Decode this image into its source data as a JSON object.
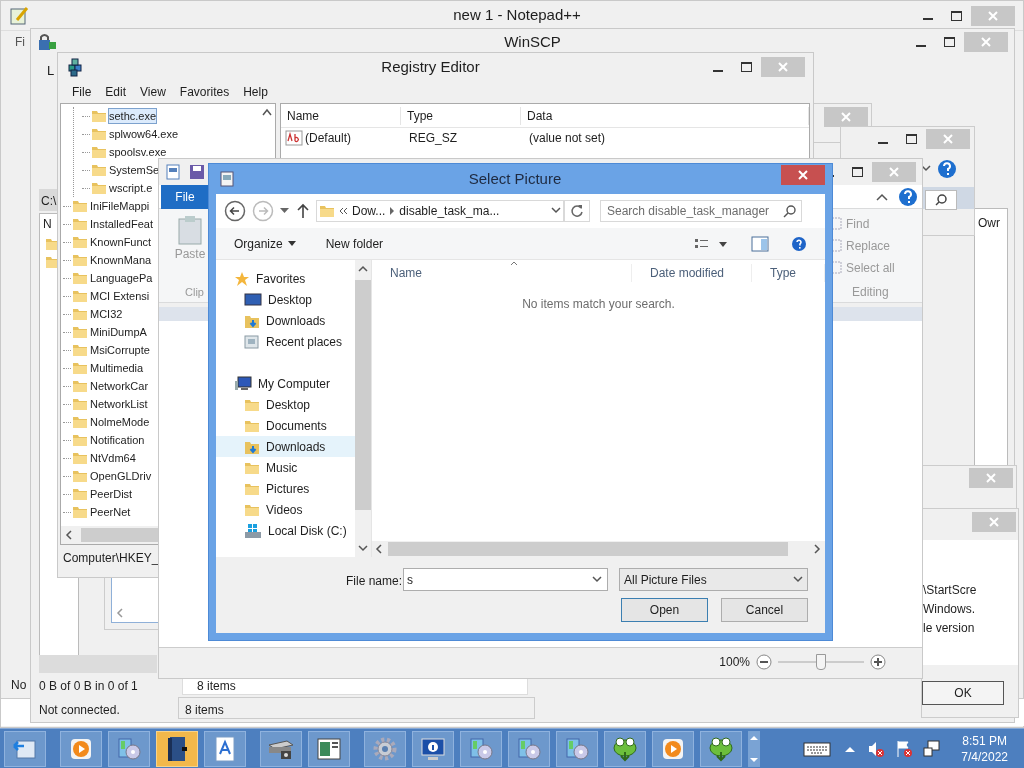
{
  "notepad": {
    "title": "new 1 - Notepad++",
    "menu_fragment": "Fi",
    "status_fragment": "No"
  },
  "winscp": {
    "title": "WinSCP",
    "toolbar_fragment": "L",
    "path_fragment": "C:\\",
    "column_fragment": "N",
    "status": [
      "0 B of 0 B in 0 of 1",
      "Not connected."
    ]
  },
  "explorer_windows": [
    {
      "status": "8 items"
    },
    {
      "status": "8 items"
    }
  ],
  "right_panel": {
    "column_fragment": "Owr"
  },
  "message_box": {
    "lines": [
      "\\StartScre",
      "Windows.",
      "le version"
    ],
    "button": "OK"
  },
  "wordpad": {
    "file_tab": "File",
    "paste": "Paste",
    "clipboard_fragment": "Clip",
    "editing_items": [
      "Find",
      "Replace",
      "Select all"
    ],
    "editing_group": "Editing",
    "zoom": "100%",
    "zoom_slider": {
      "level": 0.5
    }
  },
  "registry_editor": {
    "title": "Registry Editor",
    "menu": [
      "File",
      "Edit",
      "View",
      "Favorites",
      "Help"
    ],
    "tree": [
      {
        "children": [
          {
            "label": "sethc.exe",
            "selected": true
          },
          {
            "label": "splwow64.exe",
            "selected": false
          },
          {
            "label": "spoolsv.exe",
            "selected": false
          },
          {
            "label": "SystemSe",
            "selected": false
          },
          {
            "label": "wscript.e",
            "selected": false
          }
        ]
      },
      {
        "label": "IniFileMappi",
        "selected": false
      },
      {
        "label": "InstalledFeat",
        "selected": false
      },
      {
        "label": "KnownFunct",
        "selected": false
      },
      {
        "label": "KnownMana",
        "selected": false
      },
      {
        "label": "LanguagePa",
        "selected": false
      },
      {
        "label": "MCI Extensi",
        "selected": false
      },
      {
        "label": "MCI32",
        "selected": false
      },
      {
        "label": "MiniDumpA",
        "selected": false
      },
      {
        "label": "MsiCorrupte",
        "selected": false
      },
      {
        "label": "Multimedia",
        "selected": false
      },
      {
        "label": "NetworkCar",
        "selected": false
      },
      {
        "label": "NetworkList",
        "selected": false
      },
      {
        "label": "NolmeMode",
        "selected": false
      },
      {
        "label": "Notification",
        "selected": false
      },
      {
        "label": "NtVdm64",
        "selected": false
      },
      {
        "label": "OpenGLDriv",
        "selected": false
      },
      {
        "label": "PeerDist",
        "selected": false
      },
      {
        "label": "PeerNet",
        "selected": false
      }
    ],
    "columns": [
      "Name",
      "Type",
      "Data"
    ],
    "rows": [
      [
        "(Default)",
        "REG_SZ",
        "(value not set)"
      ]
    ],
    "status": "Computer\\HKEY_"
  },
  "dialog": {
    "title": "Select Picture",
    "breadcrumb": [
      "Dow...",
      "disable_task_ma..."
    ],
    "search": {
      "placeholder": "Search disable_task_manager"
    },
    "toolbar": [
      "Organize",
      "New folder"
    ],
    "nav": [
      {
        "label": "Favorites",
        "kind": "star",
        "children": [
          {
            "label": "Desktop",
            "kind": "screen",
            "selected": false
          },
          {
            "label": "Downloads",
            "kind": "download",
            "selected": false
          },
          {
            "label": "Recent places",
            "kind": "recent",
            "selected": false
          }
        ]
      },
      {
        "label": "My Computer",
        "kind": "computer",
        "children": [
          {
            "label": "Desktop",
            "kind": "folder",
            "selected": false
          },
          {
            "label": "Documents",
            "kind": "folder",
            "selected": false
          },
          {
            "label": "Downloads",
            "kind": "download",
            "selected": true
          },
          {
            "label": "Music",
            "kind": "folder",
            "selected": false
          },
          {
            "label": "Pictures",
            "kind": "folder",
            "selected": false
          },
          {
            "label": "Videos",
            "kind": "folder",
            "selected": false
          },
          {
            "label": "Local Disk (C:)",
            "kind": "drive",
            "selected": false
          }
        ]
      }
    ],
    "columns": [
      "Name",
      "Date modified",
      "Type"
    ],
    "empty_message": "No items match your search.",
    "file_name_label": "File name:",
    "file_name": "s",
    "filter": "All Picture Files",
    "buttons": [
      "Open",
      "Cancel"
    ]
  },
  "taskbar": {
    "buttons": [
      {
        "kind": "back",
        "active": false
      },
      {
        "kind": "player",
        "active": false
      },
      {
        "kind": "installer",
        "active": false
      },
      {
        "kind": "book",
        "active": true
      },
      {
        "kind": "wordpad",
        "active": false
      },
      {
        "kind": "scanner",
        "active": false
      },
      {
        "kind": "panel",
        "active": false
      },
      {
        "kind": "gear",
        "active": false
      },
      {
        "kind": "monitor",
        "active": false
      },
      {
        "kind": "installer",
        "active": false
      },
      {
        "kind": "installer",
        "active": false
      },
      {
        "kind": "installer",
        "active": false
      },
      {
        "kind": "frog",
        "active": false
      },
      {
        "kind": "player",
        "active": false
      },
      {
        "kind": "frog",
        "active": false
      }
    ],
    "time": "8:51 PM",
    "date": "7/4/2022"
  }
}
